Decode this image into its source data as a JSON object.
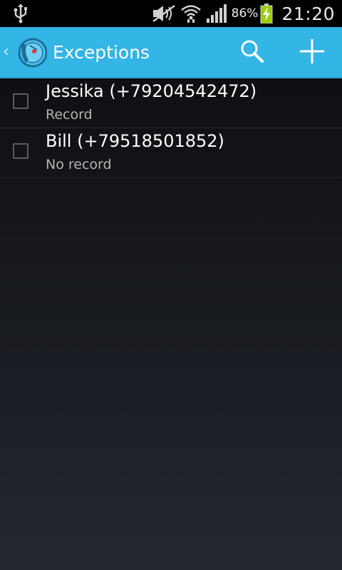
{
  "status_bar": {
    "battery_percent": "86%",
    "time": "21:20"
  },
  "action_bar": {
    "title": "Exceptions",
    "background_color": "#33b5e5"
  },
  "icons": {
    "usb": "usb-icon",
    "mute": "mute-icon",
    "wifi": "wifi-icon",
    "signal": "signal-icon",
    "battery": "battery-charging-icon",
    "app": "call-recorder-app-icon",
    "search": "search-icon",
    "add": "plus-icon"
  },
  "items": [
    {
      "name": "Jessika (+79204542472)",
      "status": "Record"
    },
    {
      "name": "Bill (+79518501852)",
      "status": "No record"
    }
  ]
}
